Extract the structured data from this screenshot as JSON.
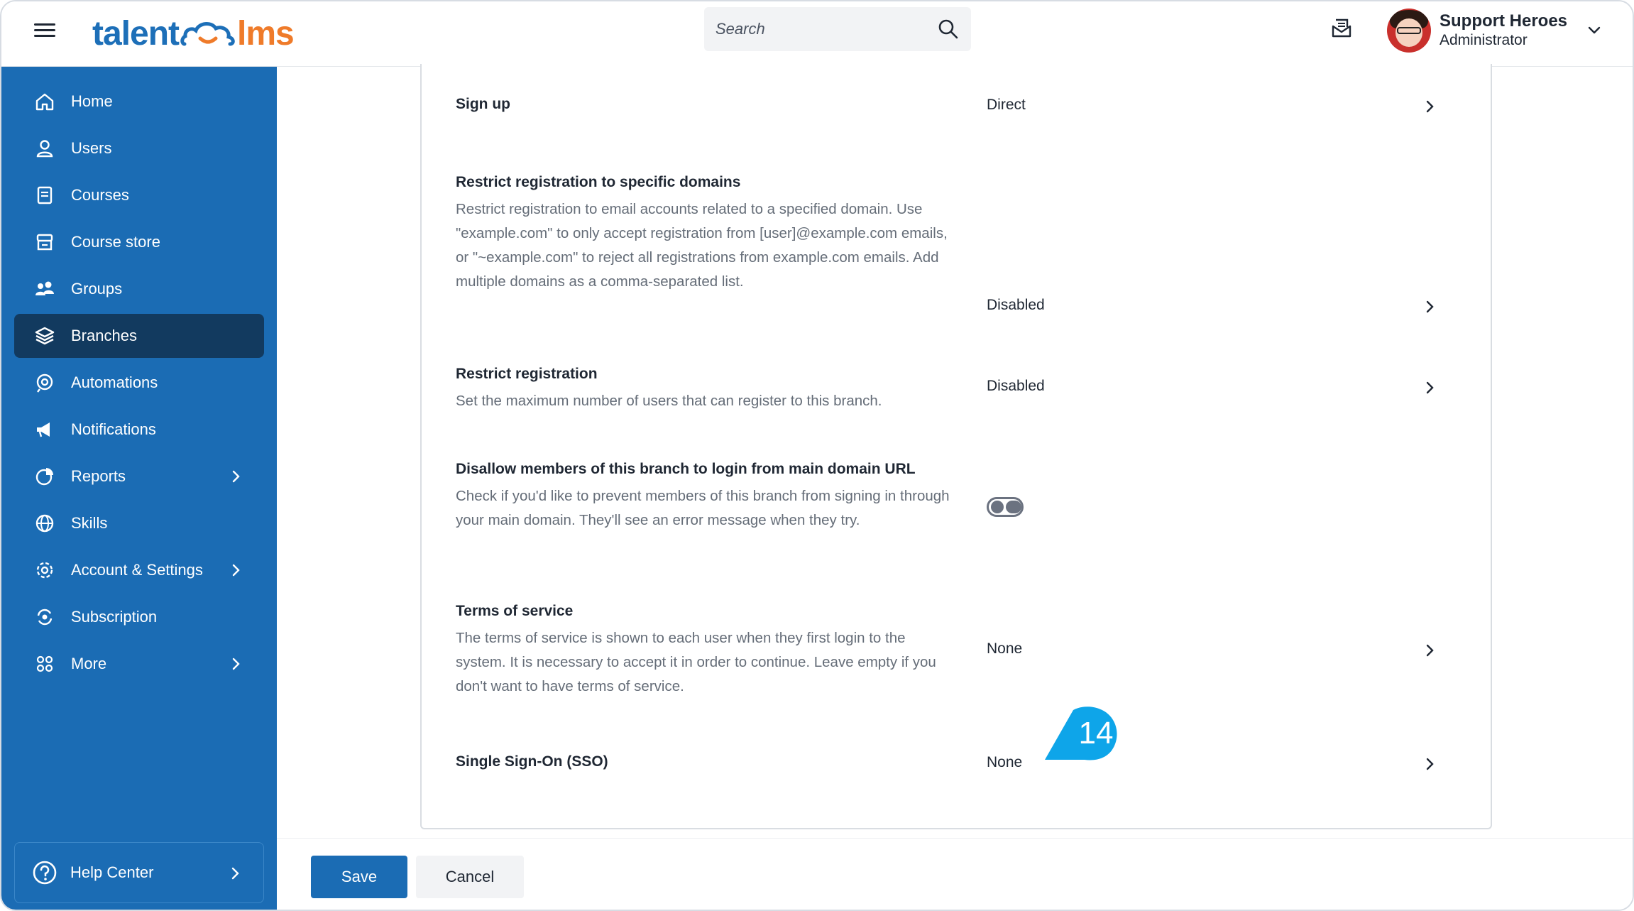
{
  "header": {
    "logo_part1": "talent",
    "logo_part2": "lms",
    "search_placeholder": "Search",
    "user_name": "Support Heroes",
    "user_role": "Administrator"
  },
  "sidebar": {
    "items": [
      {
        "label": "Home",
        "icon": "home-icon"
      },
      {
        "label": "Users",
        "icon": "user-icon"
      },
      {
        "label": "Courses",
        "icon": "book-icon"
      },
      {
        "label": "Course store",
        "icon": "store-icon"
      },
      {
        "label": "Groups",
        "icon": "groups-icon"
      },
      {
        "label": "Branches",
        "icon": "layers-icon",
        "active": true
      },
      {
        "label": "Automations",
        "icon": "automation-icon"
      },
      {
        "label": "Notifications",
        "icon": "megaphone-icon"
      },
      {
        "label": "Reports",
        "icon": "pie-chart-icon",
        "has_submenu": true
      },
      {
        "label": "Skills",
        "icon": "globe-icon"
      },
      {
        "label": "Account & Settings",
        "icon": "gear-icon",
        "has_submenu": true
      },
      {
        "label": "Subscription",
        "icon": "subscription-icon"
      },
      {
        "label": "More",
        "icon": "grid-icon",
        "has_submenu": true
      }
    ],
    "help_label": "Help Center"
  },
  "settings": {
    "signup": {
      "title": "Sign up",
      "value": "Direct"
    },
    "restrict_domains": {
      "title": "Restrict registration to specific domains",
      "description": "Restrict registration to email accounts related to a specified domain. Use \"example.com\" to only accept registration from [user]@example.com emails, or \"~example.com\" to reject all registrations from example.com emails. Add multiple domains as a comma-separated list.",
      "value": "Disabled"
    },
    "restrict_registration": {
      "title": "Restrict registration",
      "description": "Set the maximum number of users that can register to this branch.",
      "value": "Disabled"
    },
    "disallow_main_login": {
      "title": "Disallow members of this branch to login from main domain URL",
      "description": "Check if you'd like to prevent members of this branch from signing in through your main domain. They'll see an error message when they try.",
      "enabled": false
    },
    "terms": {
      "title": "Terms of service",
      "description": "The terms of service is shown to each user when they first login to the system. It is necessary to accept it in order to continue. Leave empty if you don't want to have terms of service.",
      "value": "None"
    },
    "sso": {
      "title": "Single Sign-On (SSO)",
      "value": "None"
    }
  },
  "callout_number": "14",
  "footer": {
    "save_label": "Save",
    "cancel_label": "Cancel"
  },
  "colors": {
    "sidebar": "#1b6cb4",
    "active": "#123a5f",
    "accent_orange": "#ef7b2a",
    "callout": "#0ea5e9"
  }
}
